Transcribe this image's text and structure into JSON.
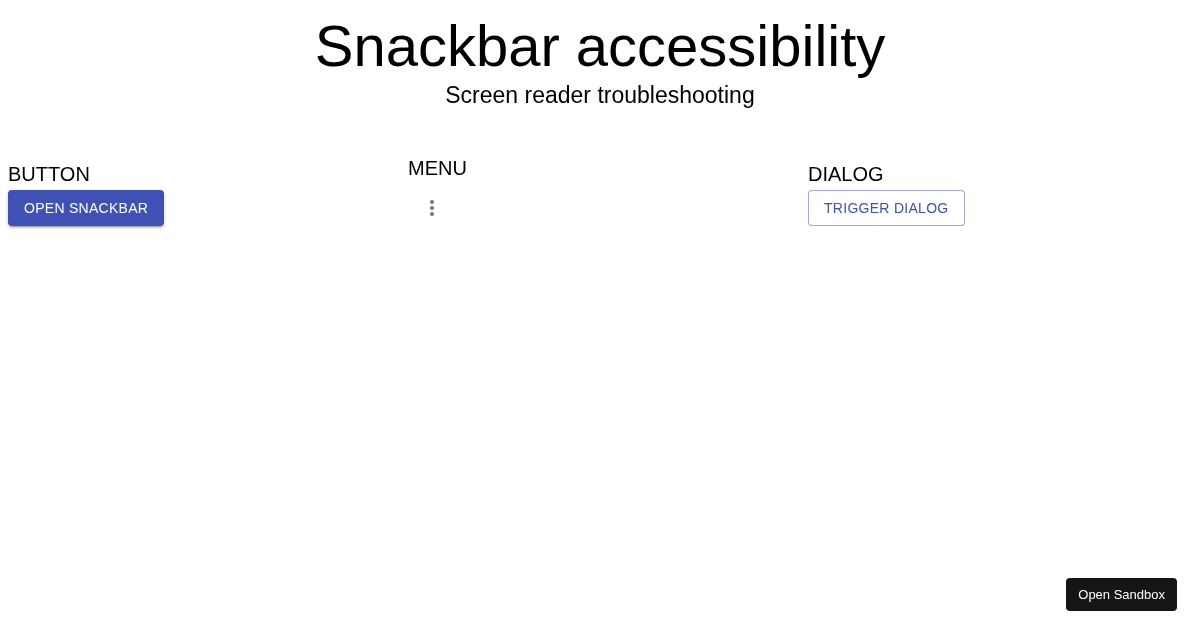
{
  "header": {
    "title": "Snackbar accessibility",
    "subtitle": "Screen reader troubleshooting"
  },
  "sections": [
    {
      "kind": "contained",
      "heading": "BUTTON",
      "button": {
        "label": "OPEN SNACKBAR"
      }
    },
    {
      "kind": "icon",
      "heading": "MENU"
    },
    {
      "kind": "outlined",
      "heading": "DIALOG",
      "button": {
        "label": "TRIGGER DIALOG"
      }
    }
  ],
  "sandbox_button": {
    "label": "Open Sandbox"
  }
}
